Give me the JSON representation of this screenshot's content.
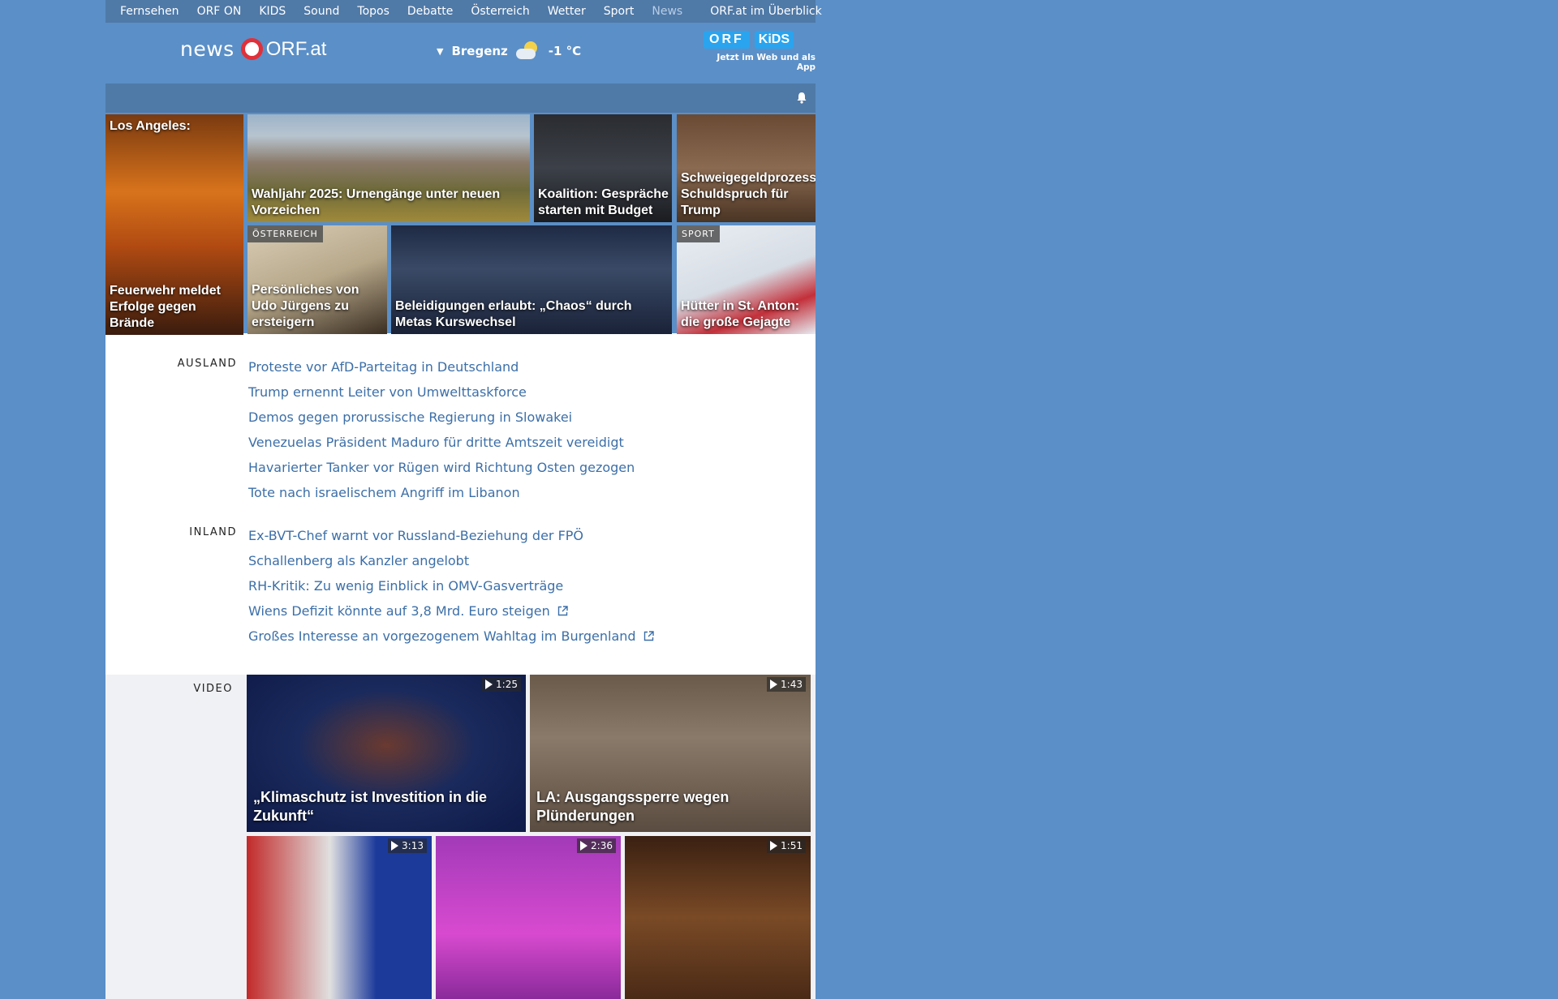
{
  "topnav": {
    "items": [
      "Fernsehen",
      "ORF ON",
      "KIDS",
      "Sound",
      "Topos",
      "Debatte",
      "Österreich",
      "Wetter",
      "Sport",
      "News"
    ],
    "active": "News",
    "overview": "ORF.at im Überblick"
  },
  "header": {
    "logo_news": "news",
    "logo_orf": "ORF.at",
    "weather_city": "Bregenz",
    "weather_icon": "sun-cloud-icon",
    "weather_temp": "-1 °C",
    "kids_orf": "ORF",
    "kids_label": "KiDS",
    "kids_tagline": "Jetzt im Web und als App"
  },
  "teasers": [
    {
      "top": "Los Angeles:",
      "title": "Feuerwehr meldet Erfolge gegen Brände",
      "kicker": ""
    },
    {
      "top": "",
      "title": "Wahljahr 2025: Urnengänge unter neuen Vorzeichen",
      "kicker": ""
    },
    {
      "top": "",
      "title": "Koalition: Gespräche starten mit Budget",
      "kicker": ""
    },
    {
      "top": "",
      "title": "Schweigegeldprozess: Schuldspruch für Trump",
      "kicker": ""
    },
    {
      "top": "",
      "title": "Persönliches von Udo Jürgens zu ersteigern",
      "kicker": "ÖSTERREICH"
    },
    {
      "top": "",
      "title": "Beleidigungen erlaubt: „Chaos“ durch Metas Kurswechsel",
      "kicker": ""
    },
    {
      "top": "",
      "title": "Hütter in St. Anton: die große Gejagte",
      "kicker": "SPORT"
    }
  ],
  "ausland": {
    "label": "AUSLAND",
    "items": [
      "Proteste vor AfD-Parteitag in Deutschland",
      "Trump ernennt Leiter von Umwelttaskforce",
      "Demos gegen prorussische Regierung in Slowakei",
      "Venezuelas Präsident Maduro für dritte Amtszeit vereidigt",
      "Havarierter Tanker vor Rügen wird Richtung Osten gezogen",
      "Tote nach israelischem Angriff im Libanon"
    ]
  },
  "inland": {
    "label": "INLAND",
    "items": [
      "Ex-BVT-Chef warnt vor Russland-Beziehung der FPÖ",
      "Schallenberg als Kanzler angelobt",
      "RH-Kritik: Zu wenig Einblick in OMV-Gasverträge",
      "Wiens Defizit könnte auf 3,8 Mrd. Euro steigen",
      "Großes Interesse an vorgezogenem Wahltag im Burgenland"
    ]
  },
  "video": {
    "label": "VIDEO",
    "items": [
      {
        "title": "„Klimaschutz ist Investition in die Zukunft“",
        "duration": "1:25"
      },
      {
        "title": "LA: Ausgangssperre wegen Plünderungen",
        "duration": "1:43"
      },
      {
        "title": "",
        "duration": "3:13"
      },
      {
        "title": "",
        "duration": "2:36"
      },
      {
        "title": "",
        "duration": "1:51"
      }
    ]
  },
  "colors": {
    "background": "#5b8fc7",
    "nav": "#4f79a7",
    "link": "#3c6fa8",
    "logo_red": "#e0303a",
    "kids_blue": "#2aa4ee"
  }
}
